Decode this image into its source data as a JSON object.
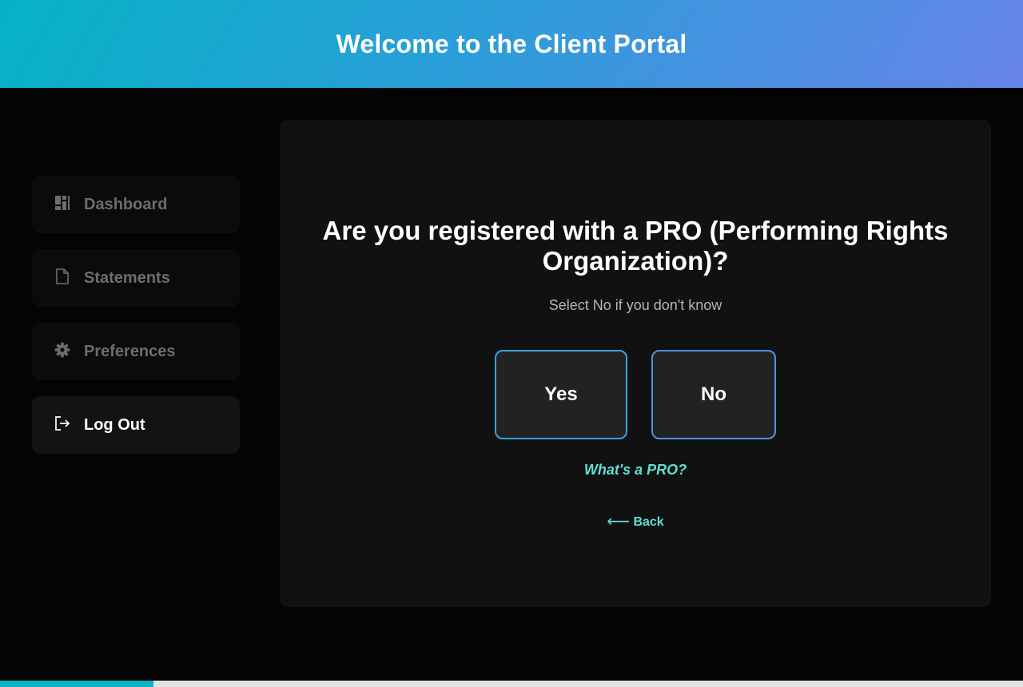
{
  "header": {
    "title": "Welcome to the Client Portal"
  },
  "sidebar": {
    "items": [
      {
        "label": "Dashboard",
        "icon": "dashboard-icon"
      },
      {
        "label": "Statements",
        "icon": "document-icon"
      },
      {
        "label": "Preferences",
        "icon": "gear-icon"
      },
      {
        "label": "Log Out",
        "icon": "logout-icon"
      }
    ]
  },
  "main": {
    "question": "Are you registered with a PRO (Performing Rights Organization)?",
    "subtitle": "Select No if you don't know",
    "yes_label": "Yes",
    "no_label": "No",
    "help_link": "What's a PRO?",
    "back_arrow": "⟵",
    "back_label": "Back"
  },
  "progress": {
    "fraction": 0.15
  },
  "colors": {
    "accent": "#5ee0d3",
    "header_gradient_start": "#06b3c6",
    "header_gradient_end": "#6784ea",
    "button_border": "#34a4dc",
    "progress_fill": "#0bb4c4"
  }
}
